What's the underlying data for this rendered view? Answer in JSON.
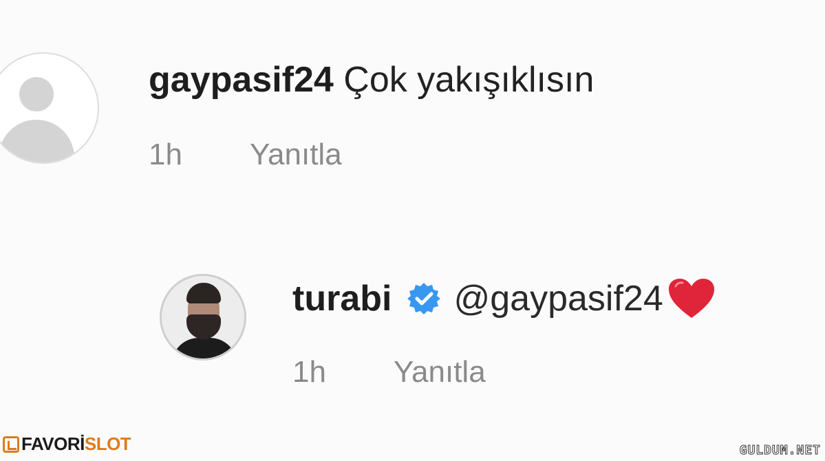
{
  "comment1": {
    "username": "gaypasif24",
    "text": "Çok yakışıklısın",
    "time": "1h",
    "reply_label": "Yanıtla",
    "avatar_icon": "default-profile-icon"
  },
  "comment2": {
    "username": "turabi",
    "verified_icon": "verified-badge-icon",
    "mention": "@gaypasif24",
    "emoji_icon": "red-heart-icon",
    "time": "1h",
    "reply_label": "Yanıtla"
  },
  "watermarks": {
    "left_part1": "FAVORİ",
    "left_part2": "SLOT",
    "right": "GULDUM.NET"
  },
  "colors": {
    "verified_blue": "#3897f0",
    "heart_red": "#e0243a",
    "meta_gray": "#8a8a8a",
    "brand_orange": "#e07a1c"
  }
}
